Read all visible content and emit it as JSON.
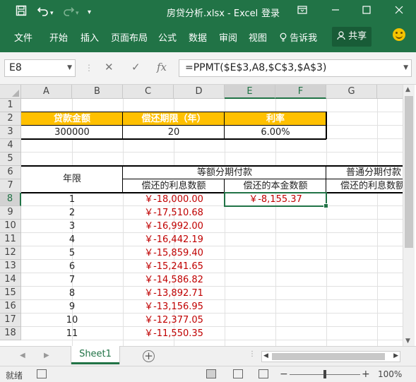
{
  "titlebar": {
    "save_icon": "save-icon",
    "undo_icon": "undo-icon",
    "redo_icon": "redo-icon",
    "customize_icon": "customize-quick-access-icon",
    "title": "房贷分析.xlsx - Excel",
    "login": "登录"
  },
  "ribbon": {
    "tabs": [
      "文件",
      "开始",
      "插入",
      "页面布局",
      "公式",
      "数据",
      "审阅",
      "视图"
    ],
    "tell_me": "告诉我",
    "share": "共享"
  },
  "formula_bar": {
    "name_box": "E8",
    "formula": "=PPMT($E$3,A8,$C$3,$A$3)"
  },
  "columns": [
    "A",
    "B",
    "C",
    "D",
    "E",
    "F",
    "G"
  ],
  "selected_column_headers": [
    "E",
    "F"
  ],
  "rows": [
    "1",
    "2",
    "3",
    "4",
    "5",
    "6",
    "7",
    "8",
    "9",
    "10",
    "11",
    "12",
    "13",
    "14",
    "15",
    "16",
    "17",
    "18"
  ],
  "selected_row": "8",
  "sheet": {
    "loan_amount_label": "贷款金额",
    "term_label": "偿还期限（年）",
    "rate_label": "利率",
    "loan_amount": "300000",
    "term": "20",
    "rate": "6.00%",
    "year_header": "年限",
    "equal_installment_header": "等额分期付款",
    "ordinary_installment_header": "普通分期付款",
    "interest_header": "偿还的利息数额",
    "principal_header": "偿还的本金数额",
    "interest_header_g": "偿还的利息数额",
    "schedule": [
      {
        "year": "1",
        "interest": "￥-18,000.00",
        "principal": "￥-8,155.37"
      },
      {
        "year": "2",
        "interest": "￥-17,510.68",
        "principal": ""
      },
      {
        "year": "3",
        "interest": "￥-16,992.00",
        "principal": ""
      },
      {
        "year": "4",
        "interest": "￥-16,442.19",
        "principal": ""
      },
      {
        "year": "5",
        "interest": "￥-15,859.40",
        "principal": ""
      },
      {
        "year": "6",
        "interest": "￥-15,241.65",
        "principal": ""
      },
      {
        "year": "7",
        "interest": "￥-14,586.82",
        "principal": ""
      },
      {
        "year": "8",
        "interest": "￥-13,892.71",
        "principal": ""
      },
      {
        "year": "9",
        "interest": "￥-13,156.95",
        "principal": ""
      },
      {
        "year": "10",
        "interest": "￥-12,377.05",
        "principal": ""
      },
      {
        "year": "11",
        "interest": "￥-11,550.35",
        "principal": ""
      }
    ]
  },
  "sheet_tabs": [
    "Sheet1"
  ],
  "status": {
    "ready": "就绪",
    "zoom": "100%"
  },
  "colors": {
    "brand": "#217346",
    "header_fill": "#ffc000",
    "negative": "#c00000"
  }
}
